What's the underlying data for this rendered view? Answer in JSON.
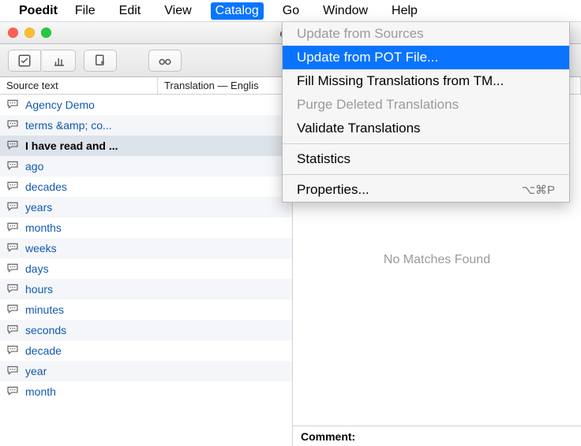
{
  "menubar": {
    "app_name": "Poedit",
    "items": [
      "File",
      "Edit",
      "View",
      "Catalog",
      "Go",
      "Window",
      "Help"
    ],
    "active_index": 3
  },
  "dropdown": {
    "items": [
      {
        "label": "Update from Sources",
        "disabled": true
      },
      {
        "label": "Update from POT File...",
        "highlight": true
      },
      {
        "label": "Fill Missing Translations from TM..."
      },
      {
        "label": "Purge Deleted Translations",
        "disabled": true
      },
      {
        "label": "Validate Translations"
      },
      {
        "separator": true
      },
      {
        "label": "Statistics"
      },
      {
        "separator": true
      },
      {
        "label": "Properties...",
        "shortcut": "⌥⌘P"
      }
    ]
  },
  "window": {
    "title": "en.p"
  },
  "columns": {
    "source": "Source text",
    "translation": "Translation — Englis"
  },
  "rows": [
    {
      "label": "Agency Demo"
    },
    {
      "label": "terms &amp; co..."
    },
    {
      "label": "I have read and ...",
      "selected": true
    },
    {
      "label": "ago"
    },
    {
      "label": "decades"
    },
    {
      "label": "years"
    },
    {
      "label": "months"
    },
    {
      "label": "weeks"
    },
    {
      "label": "days"
    },
    {
      "label": "hours"
    },
    {
      "label": "minutes"
    },
    {
      "label": "seconds"
    },
    {
      "label": "decade"
    },
    {
      "label": "year"
    },
    {
      "label": "month"
    }
  ],
  "right_pane": {
    "no_matches": "No Matches Found",
    "comment_label": "Comment:"
  },
  "toolbar_icons": {
    "validate": "validate-icon",
    "stats": "stats-icon",
    "update": "update-icon",
    "glasses": "glasses-icon"
  }
}
